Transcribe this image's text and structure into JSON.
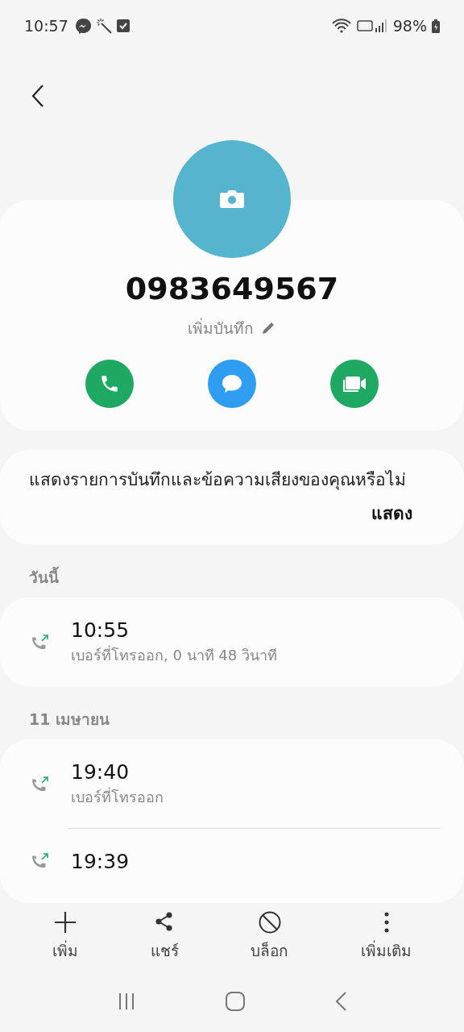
{
  "status_bar": {
    "time": "10:57",
    "battery": "98%"
  },
  "contact": {
    "number": "0983649567",
    "note_label": "เพิ่มบันทึก"
  },
  "actions": [
    {
      "kind": "call",
      "color": "#1ea862"
    },
    {
      "kind": "message",
      "color": "#2f9ef2"
    },
    {
      "kind": "video",
      "color": "#1ea862"
    }
  ],
  "prompt": {
    "text": "แสดงรายการบันทึกและข้อความเสียงของคุณหรือไม่",
    "button": "แสดง"
  },
  "call_groups": [
    {
      "date": "วันนี้",
      "calls": [
        {
          "time": "10:55",
          "detail": "เบอร์ที่โทรออก, 0 นาที 48 วินาที"
        }
      ]
    },
    {
      "date": "11 เมษายน",
      "calls": [
        {
          "time": "19:40",
          "detail": "เบอร์ที่โทรออก"
        },
        {
          "time": "19:39"
        }
      ]
    }
  ],
  "toolbar": [
    {
      "kind": "add",
      "label": "เพิ่ม"
    },
    {
      "kind": "share",
      "label": "แชร์"
    },
    {
      "kind": "block",
      "label": "บล็อก"
    },
    {
      "kind": "more",
      "label": "เพิ่มเติม"
    }
  ]
}
